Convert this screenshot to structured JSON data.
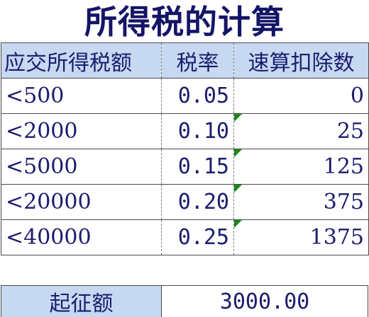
{
  "title": "所得税的计算",
  "table": {
    "headers": [
      "应交所得税额",
      "税率",
      "速算扣除数"
    ],
    "rows": [
      {
        "range": "<500",
        "rate": "0.05",
        "deduction": "0",
        "flag": false
      },
      {
        "range": "<2000",
        "rate": "0.10",
        "deduction": "25",
        "flag": true
      },
      {
        "range": "<5000",
        "rate": "0.15",
        "deduction": "125",
        "flag": true
      },
      {
        "range": "<20000",
        "rate": "0.20",
        "deduction": "375",
        "flag": true
      },
      {
        "range": "<40000",
        "rate": "0.25",
        "deduction": "1375",
        "flag": true
      }
    ]
  },
  "threshold": {
    "label": "起征额",
    "value": "3000.00"
  },
  "colors": {
    "header_fill": "#c6d9f1",
    "text": "#1c1c6e",
    "indicator": "#1a8a1a"
  }
}
